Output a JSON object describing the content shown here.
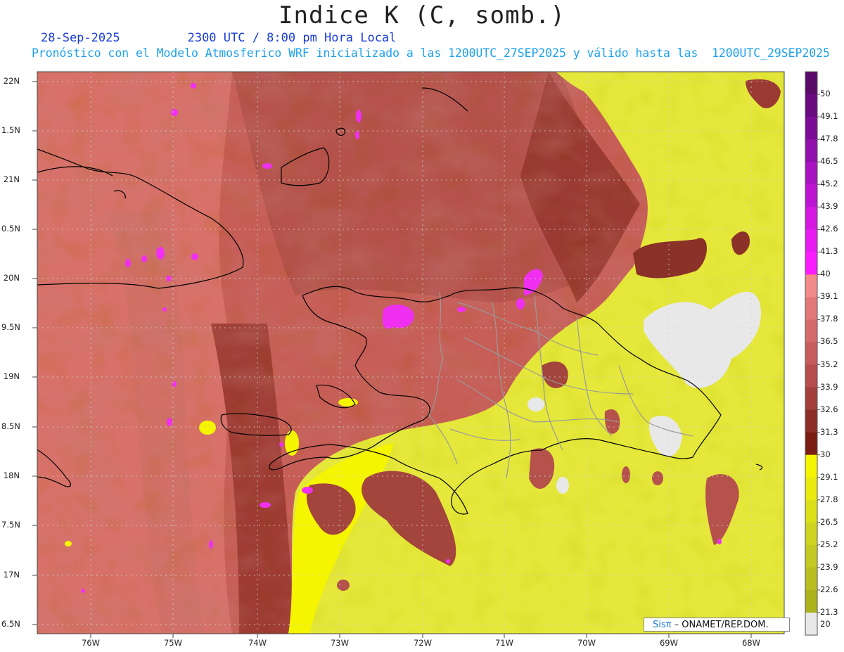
{
  "title": "Indice K (C, somb.)",
  "date": "28-Sep-2025",
  "time_text": "2300 UTC / 8:00 pm Hora Local",
  "subtitle": "Pronóstico con el Modelo Atmosferico WRF inicializado a las 1200UTC_27SEP2025 y válido hasta las  1200UTC_29SEP2025",
  "logo": {
    "brand": "Sisπ",
    "text": "– ONAMET/REP.DOM."
  },
  "lat_labels": [
    "22N",
    "1.5N",
    "21N",
    "0.5N",
    "20N",
    "9.5N",
    "19N",
    "8.5N",
    "18N",
    "7.5N",
    "17N",
    "6.5N"
  ],
  "lon_labels": [
    "76W",
    "75W",
    "74W",
    "73W",
    "72W",
    "71W",
    "70W",
    "69W",
    "68W"
  ],
  "colorbar": {
    "labels": [
      "50",
      "49.1",
      "47.8",
      "46.5",
      "45.2",
      "43.9",
      "42.6",
      "41.3",
      "40",
      "39.1",
      "37.8",
      "36.5",
      "35.2",
      "33.9",
      "32.6",
      "31.3",
      "30",
      "29.1",
      "27.8",
      "26.5",
      "25.2",
      "23.9",
      "22.6",
      "21.3",
      "20"
    ],
    "colors": [
      "#5a0a68",
      "#6a0a80",
      "#7d0c96",
      "#9210ac",
      "#a812c0",
      "#bd14d2",
      "#d418e2",
      "#e81cf0",
      "#fa1cff",
      "#f28a8a",
      "#e27878",
      "#d66a6a",
      "#c85c5c",
      "#b84c4c",
      "#a33e3a",
      "#8e2e28",
      "#7a1e14",
      "#f5f500",
      "#e8ea10",
      "#dadf18",
      "#cfd420",
      "#c4c822",
      "#b8bd20",
      "#acb21c",
      "#e8e8e8"
    ]
  },
  "colors": {
    "hot": "#b5524c",
    "warm": "#d8716a",
    "dark": "#8a3128",
    "yellow": "#e5e83a",
    "bright_yellow": "#f5f500",
    "gray": "#e8e8e8",
    "magenta": "#f030f0",
    "coast": "#000000",
    "border": "#999999"
  }
}
